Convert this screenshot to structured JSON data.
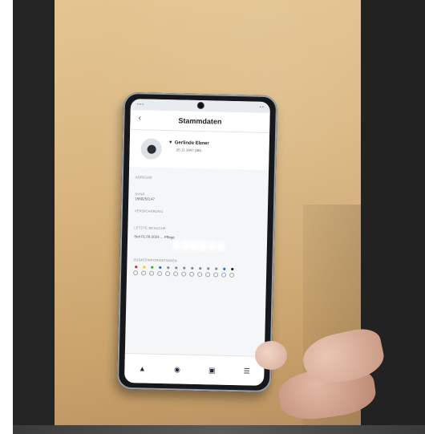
{
  "app": {
    "title": "Stammdaten"
  },
  "profile": {
    "name": "Gerlinde Ebner",
    "birth": "25.11.1947 (86)"
  },
  "sections": {
    "address_label": "ADRESSE",
    "svnr_label": "SVNR",
    "svnr_value": "1569251147",
    "insurance_label": "VERSICHERUNG",
    "last_visit_label": "LETZTE BESUCHE",
    "last_visit_value": "Seit 01.09.2024 ... Pflege",
    "extra_label": "ZUSATZINFORMATIONEN"
  },
  "status_dots": {
    "colors": [
      "#cc2222",
      "#ffcc00",
      "#33aa33",
      "#3366cc",
      "#888888",
      "#888888",
      "#888888",
      "#888888",
      "#888888",
      "#888888",
      "#888888",
      "#3366cc",
      "#222222"
    ]
  },
  "icons": {
    "back": "chevron-left-icon",
    "filter": "filter-icon",
    "avatar": "person-icon"
  }
}
